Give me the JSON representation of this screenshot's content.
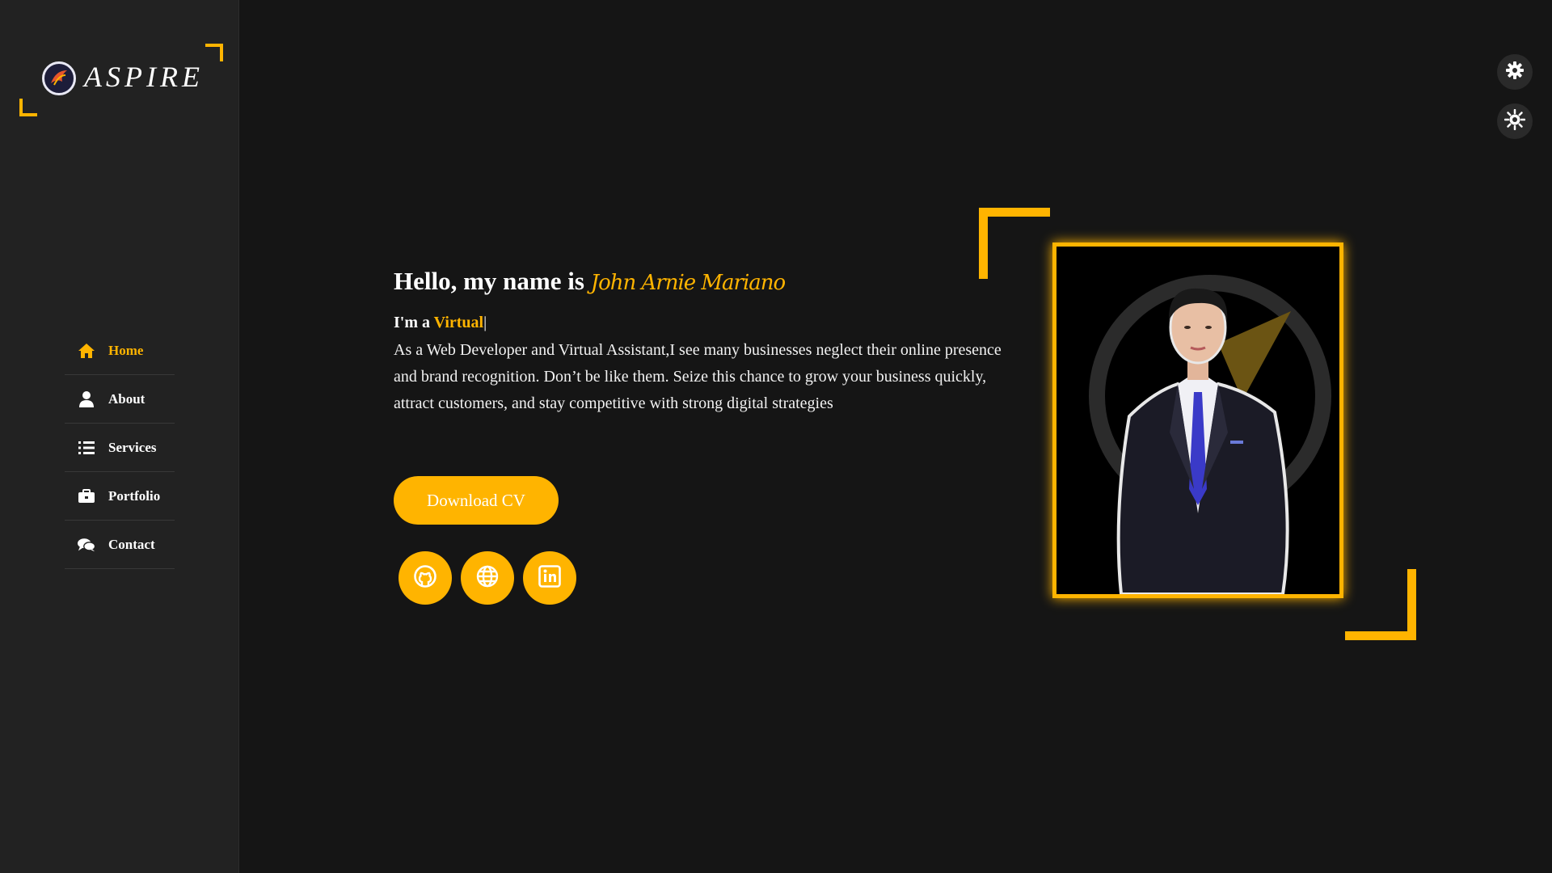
{
  "brand": {
    "logo_text": "ASPIRE",
    "accent": "#ffb400"
  },
  "nav": {
    "items": [
      {
        "label": "Home",
        "icon": "home-icon",
        "active": true
      },
      {
        "label": "About",
        "icon": "user-icon"
      },
      {
        "label": "Services",
        "icon": "list-icon"
      },
      {
        "label": "Portfolio",
        "icon": "briefcase-icon"
      },
      {
        "label": "Contact",
        "icon": "comments-icon"
      }
    ]
  },
  "settings": [
    {
      "icon": "gear-icon"
    },
    {
      "icon": "sun-gear-icon"
    }
  ],
  "hero": {
    "greeting": "Hello, my name is",
    "name": "John Arnie Mariano",
    "role_prefix": "I'm a",
    "role_word": "Virtual",
    "cursor": "|",
    "description": "As a Web Developer and Virtual Assistant,I see many businesses neglect their online presence and brand recognition. Don’t be like them. Seize this chance to grow your business quickly, attract customers, and stay competitive with strong digital strategies",
    "cv_button": "Download CV"
  },
  "socials": [
    {
      "icon": "github-icon"
    },
    {
      "icon": "globe-icon"
    },
    {
      "icon": "linkedin-icon"
    }
  ],
  "portrait": {
    "subject": "man in suit with blue tie"
  }
}
